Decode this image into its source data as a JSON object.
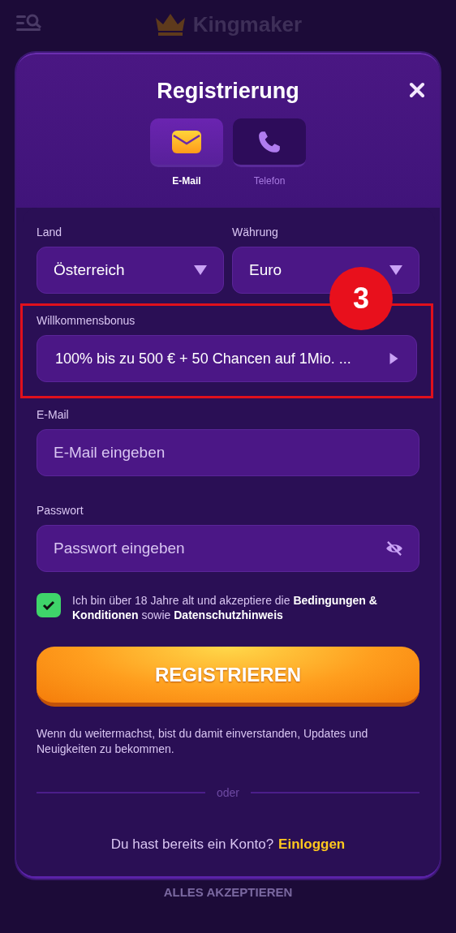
{
  "header": {
    "logo": "Kingmaker"
  },
  "modal": {
    "title": "Registrierung",
    "tabs": [
      {
        "label": "E-Mail",
        "kind": "email",
        "selected": true
      },
      {
        "label": "Telefon",
        "kind": "phone",
        "selected": false
      }
    ],
    "country": {
      "label": "Land",
      "value": "Österreich"
    },
    "currency": {
      "label": "Währung",
      "value": "Euro"
    },
    "bonus": {
      "label": "Willkommensbonus",
      "value": "100% bis zu 500 € + 50 Chancen auf 1Mio. ...",
      "highlighted": true,
      "annotation": "3"
    },
    "email": {
      "label": "E-Mail",
      "placeholder": "E-Mail eingeben"
    },
    "password": {
      "label": "Passwort",
      "placeholder": "Passwort eingeben"
    },
    "terms": {
      "checked": true,
      "text": "Ich bin über 18 Jahre alt und akzeptiere die **Bedingungen & Konditionen** sowie **Datenschutzhinweis**"
    },
    "submit": "REGISTRIEREN",
    "notice": "Wenn du weitermachst, bist du damit einverstanden, Updates und Neuigkeiten zu bekommen.",
    "divider": "oder",
    "login": {
      "prompt": "Du hast bereits ein Konto?",
      "link": "Einloggen"
    }
  },
  "background_button": "ALLES AKZEPTIEREN"
}
